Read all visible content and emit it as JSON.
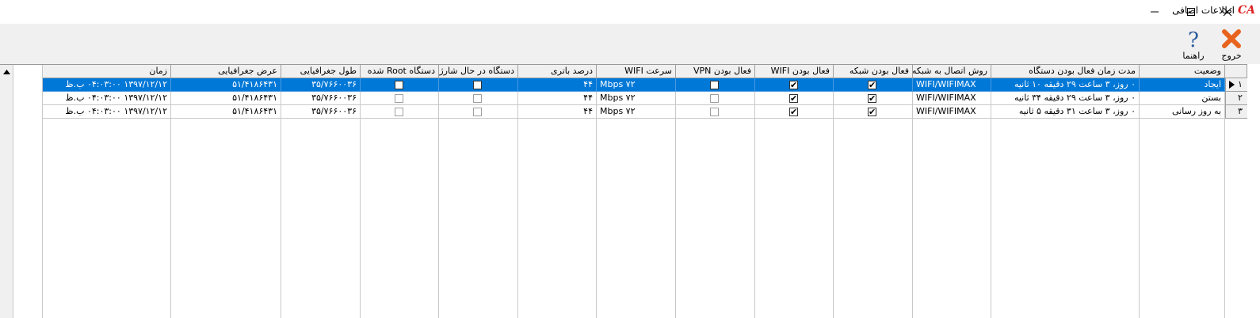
{
  "window": {
    "title": "اطلاعات اضافی",
    "app_logo": "CA",
    "controls": [
      "minimize-icon",
      "maximize-icon",
      "close-icon"
    ]
  },
  "toolbar": {
    "exit_label": "خروج",
    "help_label": "راهنما"
  },
  "grid": {
    "columns": [
      "وضعیت",
      "مدت زمان فعال بودن دستگاه",
      "روش اتصال به شبکه",
      "فعال بودن شبکه",
      "فعال بودن WIFI",
      "فعال بودن VPN",
      "سرعت WIFI",
      "درصد باتری",
      "دستگاه در حال شارژ",
      "دستگاه Root شده",
      "طول جغرافیایی",
      "عرض جغرافیایی",
      "زمان"
    ],
    "rows": [
      {
        "num": "۱",
        "status": "ایجاد",
        "uptime": "۰ روز، ۳ ساعت  ۲۹ دقیقه  ۱۰ ثانیه",
        "connection": "WIFI/WIFIMAX",
        "network_active": true,
        "wifi_active": true,
        "vpn_active": false,
        "wifi_speed": "Mbps ۷۲",
        "battery": "۴۴",
        "charging": false,
        "rooted": false,
        "longitude": "۳۵/۷۶۶۰۰۳۶",
        "latitude": "۵۱/۴۱۸۶۴۳۱",
        "time": "۱۳۹۷/۱۲/۱۲  ۰۴:۰۳:۰۰ ب.ظ"
      },
      {
        "num": "۲",
        "status": "بستن",
        "uptime": "۰ روز، ۳ ساعت  ۲۹ دقیقه  ۳۴ ثانیه",
        "connection": "WIFI/WIFIMAX",
        "network_active": true,
        "wifi_active": true,
        "vpn_active": false,
        "wifi_speed": "Mbps ۷۲",
        "battery": "۴۴",
        "charging": false,
        "rooted": false,
        "longitude": "۳۵/۷۶۶۰۰۳۶",
        "latitude": "۵۱/۴۱۸۶۴۳۱",
        "time": "۱۳۹۷/۱۲/۱۲  ۰۴:۰۳:۰۰ ب.ظ"
      },
      {
        "num": "۳",
        "status": "به روز رسانی",
        "uptime": "۰ روز، ۳ ساعت  ۳۱ دقیقه  ۵ ثانیه",
        "connection": "WIFI/WIFIMAX",
        "network_active": true,
        "wifi_active": true,
        "vpn_active": false,
        "wifi_speed": "Mbps ۷۲",
        "battery": "۴۴",
        "charging": false,
        "rooted": false,
        "longitude": "۳۵/۷۶۶۰۰۳۶",
        "latitude": "۵۱/۴۱۸۶۴۳۱",
        "time": "۱۳۹۷/۱۲/۱۲  ۰۴:۰۳:۰۰ ب.ظ"
      }
    ],
    "selected_row": 0
  },
  "colors": {
    "selection": "#0078d7",
    "exit_icon": "#e8641e",
    "help_icon": "#2b5c9c",
    "logo": "#d22222"
  }
}
